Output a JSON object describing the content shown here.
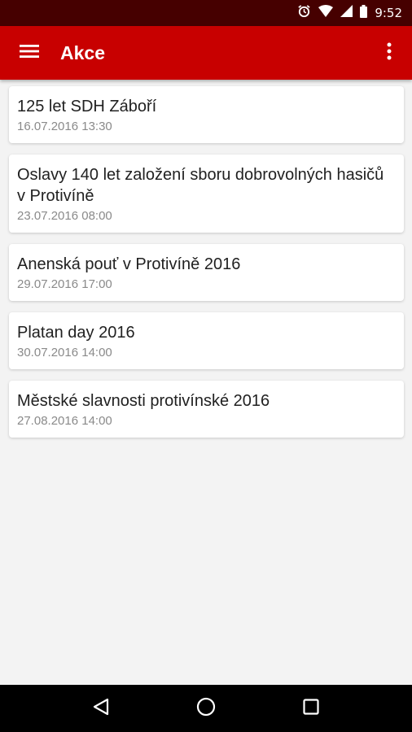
{
  "status_bar": {
    "time": "9:52",
    "icons": [
      "alarm-icon",
      "wifi-icon",
      "cell-signal-icon",
      "battery-icon"
    ]
  },
  "app_bar": {
    "title": "Akce",
    "menu_icon": "hamburger-menu-icon",
    "overflow_icon": "more-vert-icon",
    "color": "#c80000"
  },
  "events": [
    {
      "title": "125 let SDH Záboří",
      "date": "16.07.2016 13:30"
    },
    {
      "title": "Oslavy 140 let založení sboru dobrovolných hasičů v Protivíně",
      "date": "23.07.2016 08:00"
    },
    {
      "title": "Anenská pouť v Protivíně 2016",
      "date": "29.07.2016 17:00"
    },
    {
      "title": "Platan day 2016",
      "date": "30.07.2016 14:00"
    },
    {
      "title": "Městské slavnosti protivínské 2016",
      "date": "27.08.2016 14:00"
    }
  ],
  "nav_bar": {
    "icons": [
      "back-icon",
      "home-icon",
      "recents-icon"
    ]
  }
}
